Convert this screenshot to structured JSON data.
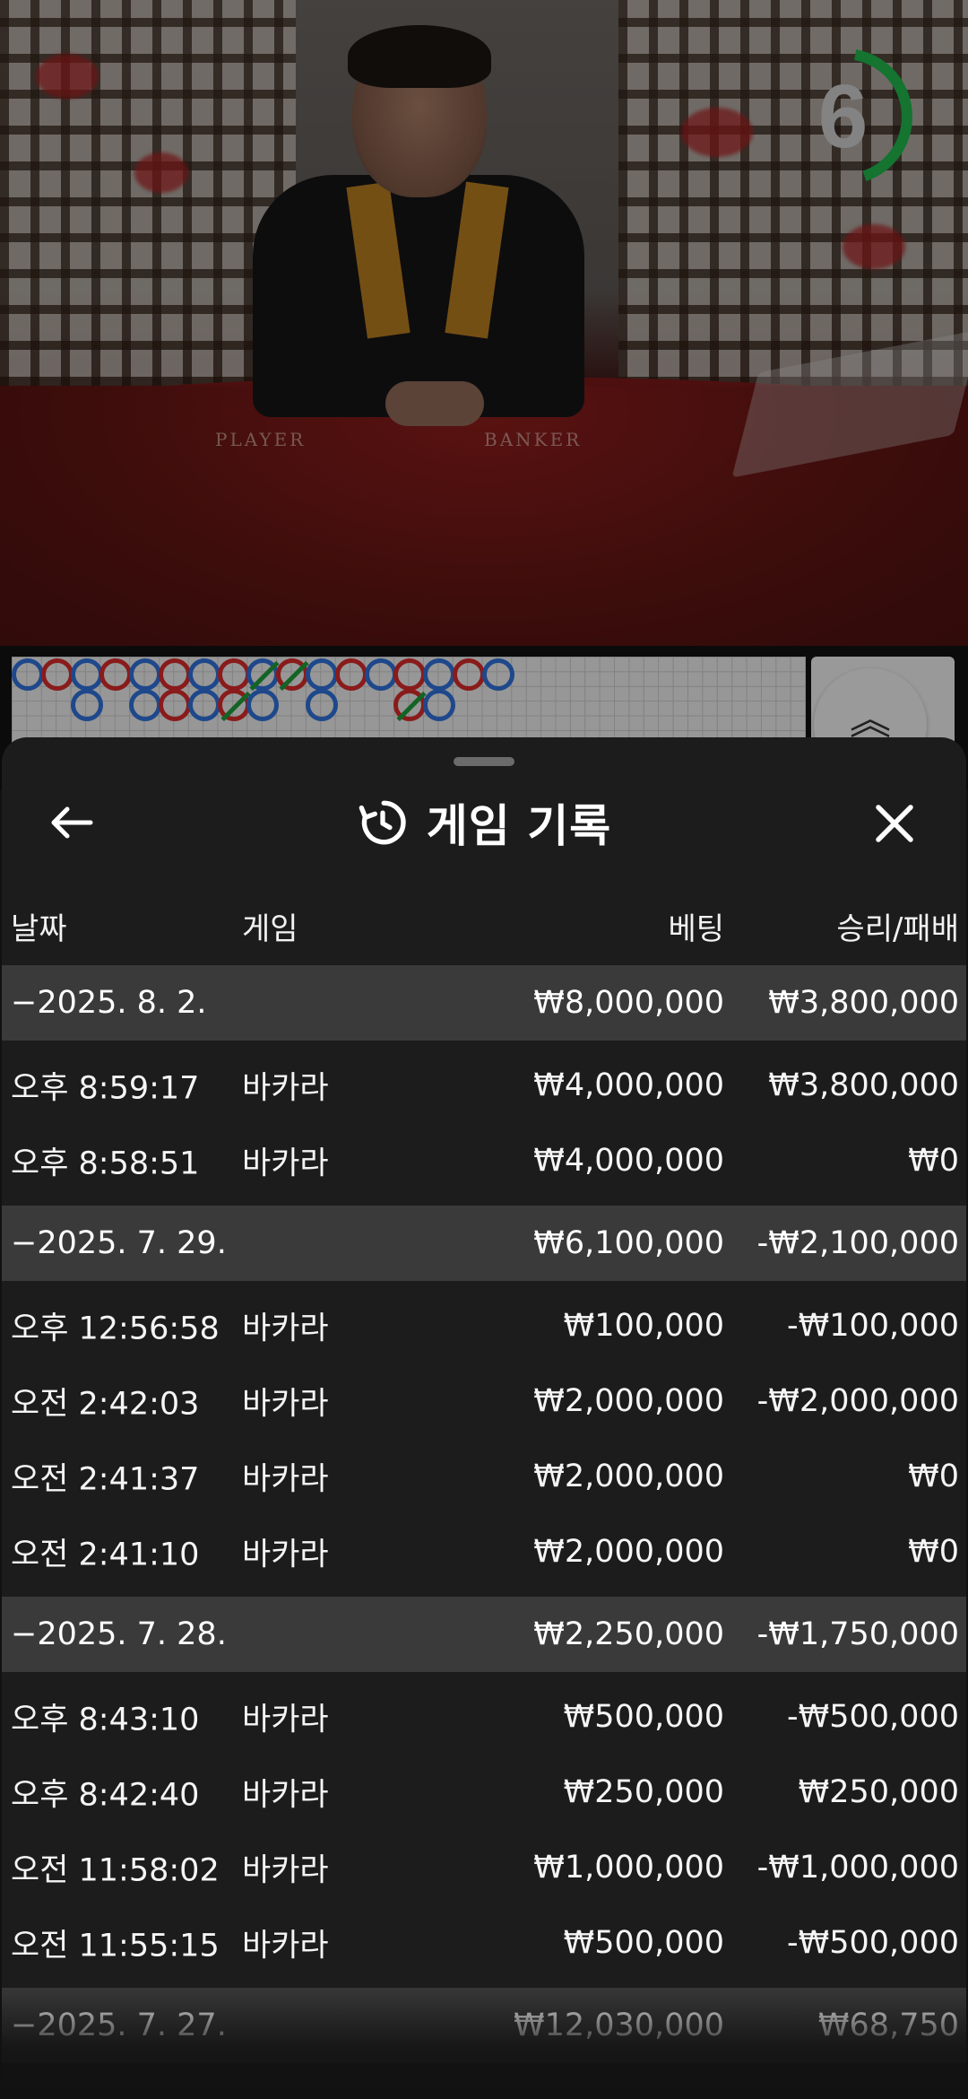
{
  "timer": {
    "value": "6",
    "progress": 0.42,
    "color": "#1fb24a"
  },
  "table": {
    "player_label": "PLAYER",
    "banker_label": "BANKER"
  },
  "roadmap": {
    "top": [
      "P",
      "B",
      "P",
      "B",
      "P",
      "B",
      "P",
      "B",
      "P",
      "B",
      "P",
      "B",
      "P",
      "B",
      "P",
      "B",
      "P"
    ],
    "top_tie": [
      false,
      false,
      false,
      false,
      false,
      false,
      false,
      false,
      true,
      true,
      false,
      false,
      false,
      false,
      false,
      false,
      false
    ],
    "bottom": [
      null,
      null,
      "P",
      null,
      "P",
      "B",
      "P",
      "B",
      "P",
      null,
      "P",
      null,
      null,
      "B",
      "P",
      null,
      null
    ],
    "bottom_tie": [
      false,
      false,
      false,
      false,
      false,
      false,
      false,
      true,
      false,
      false,
      false,
      false,
      false,
      true,
      false,
      false,
      false
    ],
    "colors": {
      "player": "#2f6fd6",
      "banker": "#d42a2a",
      "tie": "#1e9a3a"
    },
    "expand_icon": "double-chevron-up-icon"
  },
  "header": {
    "title": "게임 기록",
    "back_icon": "arrow-left-icon",
    "history_icon": "history-clock-icon",
    "close_icon": "close-icon"
  },
  "columns": {
    "date": "날짜",
    "game": "게임",
    "bet": "베팅",
    "result": "승리/패배"
  },
  "rows": [
    {
      "type": "date",
      "date": "−2025. 8. 2.",
      "bet": "₩8,000,000",
      "result": "₩3,800,000"
    },
    {
      "type": "tx",
      "time": "오후 8:59:17",
      "game": "바카라",
      "bet": "₩4,000,000",
      "result": "₩3,800,000"
    },
    {
      "type": "tx",
      "time": "오후 8:58:51",
      "game": "바카라",
      "bet": "₩4,000,000",
      "result": "₩0"
    },
    {
      "type": "date",
      "date": "−2025. 7. 29.",
      "bet": "₩6,100,000",
      "result": "-₩2,100,000"
    },
    {
      "type": "tx",
      "time": "오후 12:56:58",
      "game": "바카라",
      "bet": "₩100,000",
      "result": "-₩100,000"
    },
    {
      "type": "tx",
      "time": "오전 2:42:03",
      "game": "바카라",
      "bet": "₩2,000,000",
      "result": "-₩2,000,000"
    },
    {
      "type": "tx",
      "time": "오전 2:41:37",
      "game": "바카라",
      "bet": "₩2,000,000",
      "result": "₩0"
    },
    {
      "type": "tx",
      "time": "오전 2:41:10",
      "game": "바카라",
      "bet": "₩2,000,000",
      "result": "₩0"
    },
    {
      "type": "date",
      "date": "−2025. 7. 28.",
      "bet": "₩2,250,000",
      "result": "-₩1,750,000"
    },
    {
      "type": "tx",
      "time": "오후 8:43:10",
      "game": "바카라",
      "bet": "₩500,000",
      "result": "-₩500,000"
    },
    {
      "type": "tx",
      "time": "오후 8:42:40",
      "game": "바카라",
      "bet": "₩250,000",
      "result": "₩250,000"
    },
    {
      "type": "tx",
      "time": "오전 11:58:02",
      "game": "바카라",
      "bet": "₩1,000,000",
      "result": "-₩1,000,000"
    },
    {
      "type": "tx",
      "time": "오전 11:55:15",
      "game": "바카라",
      "bet": "₩500,000",
      "result": "-₩500,000"
    },
    {
      "type": "date",
      "date": "−2025. 7. 27.",
      "bet": "₩12,030,000",
      "result": "₩68,750"
    }
  ]
}
